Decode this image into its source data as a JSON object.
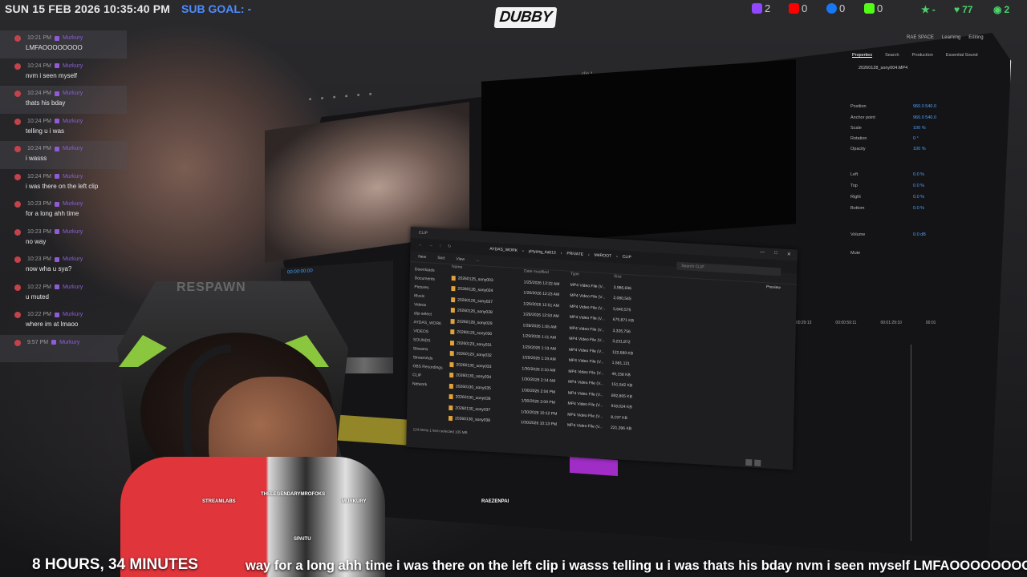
{
  "overlay": {
    "datetime": "SUN 15 FEB 2026 10:35:40 PM",
    "sub_goal": "SUB GOAL: -",
    "logo": "DUBBY",
    "socials": [
      {
        "icon": "twitch-icon",
        "count": "2",
        "color": "#9146ff"
      },
      {
        "icon": "youtube-icon",
        "count": "0",
        "color": "#ff0000"
      },
      {
        "icon": "facebook-icon",
        "count": "0",
        "color": "#1877f2"
      },
      {
        "icon": "kick-icon",
        "count": "0",
        "color": "#53fc18"
      }
    ],
    "stats": [
      {
        "icon": "star-icon",
        "count": "-"
      },
      {
        "icon": "heart-icon",
        "count": "77"
      },
      {
        "icon": "eye-icon",
        "count": "2"
      }
    ],
    "uptime": "8 HOURS, 34 MINUTES",
    "ticker": "way for a long ahh time i was there on the left clip i wasss telling u i was thats his bday nvm i seen myself LMFAOOOOOOOO"
  },
  "chat": [
    {
      "time": "10:21 PM",
      "user": "Murkury",
      "message": "LMFAOOOOOOOO",
      "highlight": true
    },
    {
      "time": "10:24 PM",
      "user": "Murkury",
      "message": "nvm i seen myself",
      "highlight": false
    },
    {
      "time": "10:24 PM",
      "user": "Murkury",
      "message": "thats his bday",
      "highlight": true
    },
    {
      "time": "10:24 PM",
      "user": "Murkury",
      "message": "telling u i was",
      "highlight": false
    },
    {
      "time": "10:24 PM",
      "user": "Murkury",
      "message": "i wasss",
      "highlight": true
    },
    {
      "time": "10:24 PM",
      "user": "Murkury",
      "message": "i was there on the left clip",
      "highlight": false
    },
    {
      "time": "10:23 PM",
      "user": "Murkury",
      "message": "for a long ahh time",
      "highlight": false
    },
    {
      "time": "10:23 PM",
      "user": "Murkury",
      "message": "no way",
      "highlight": false
    },
    {
      "time": "10:23 PM",
      "user": "Murkury",
      "message": "now wha u sya?",
      "highlight": false
    },
    {
      "time": "10:22 PM",
      "user": "Murkury",
      "message": "u muted",
      "highlight": false
    },
    {
      "time": "10:22 PM",
      "user": "Murkury",
      "message": "where im at lmaoo",
      "highlight": false
    },
    {
      "time": "9:57 PM",
      "user": "Murkury",
      "message": "",
      "highlight": true
    }
  ],
  "editor": {
    "sequence_title": "clip 1",
    "menu": [
      "RAE SPACE",
      "Learning",
      "Editing"
    ],
    "timecode": "00:00:00:00",
    "props_tabs": [
      "Properties",
      "Search",
      "Production",
      "Essential Sound"
    ],
    "props_file": "20260128_sony004.MP4",
    "props": [
      {
        "label": "Position",
        "value": "960.0   540.0"
      },
      {
        "label": "Anchor point",
        "value": "960.0   540.0"
      },
      {
        "label": "Scale",
        "value": "100 %"
      },
      {
        "label": "Rotation",
        "value": "0 °"
      },
      {
        "label": "Opacity",
        "value": "100 %"
      },
      {
        "label": "Left",
        "value": "0.0 %"
      },
      {
        "label": "Top",
        "value": "0.0 %"
      },
      {
        "label": "Right",
        "value": "0.0 %"
      },
      {
        "label": "Bottom",
        "value": "0.0 %"
      },
      {
        "label": "Volume",
        "value": "0.0 dB"
      },
      {
        "label": "Mute",
        "value": ""
      }
    ],
    "timeline_ticks": [
      "00:00:29:13",
      "00:00:59:11",
      "00:01:29:10",
      "00:01"
    ]
  },
  "explorer": {
    "title": "CLIP",
    "crumbs": [
      "AYDAS_WORK",
      "yinyang_4ab13",
      "PRIVATE",
      "M4ROOT",
      "CLIP"
    ],
    "search_placeholder": "Search CLIP",
    "toolbar": [
      "New",
      "Sort",
      "View",
      "..."
    ],
    "preview_label": "Preview",
    "sidebar": [
      "Downloads",
      "Documents",
      "Pictures",
      "Music",
      "Videos",
      "clip-select",
      "AYDAS_WORK",
      "VIDEOS",
      "SOUNDS",
      "Streams",
      "StreamAds",
      "OBS Recordings",
      "CLIP",
      "Network"
    ],
    "columns": [
      "Name",
      "Date modified",
      "Type",
      "Size"
    ],
    "rows": [
      {
        "name": "20260125_sony003",
        "date": "1/25/2026 12:22 AM",
        "type": "MP4 Video File (V...",
        "size": "3,986,696"
      },
      {
        "name": "20260126_sony024",
        "date": "1/26/2026 12:23 AM",
        "type": "MP4 Video File (V...",
        "size": "2,080,545"
      },
      {
        "name": "20260126_sony027",
        "date": "1/26/2026 12:51 AM",
        "type": "MP4 Video File (V...",
        "size": "5,640,575"
      },
      {
        "name": "20260126_sony028",
        "date": "1/26/2026 12:53 AM",
        "type": "MP4 Video File (V...",
        "size": "675,871 KB"
      },
      {
        "name": "20260128_sony029",
        "date": "1/28/2026 1:05 AM",
        "type": "MP4 Video File (V...",
        "size": "3,326,756"
      },
      {
        "name": "20260129_sony030",
        "date": "1/29/2026 1:11 AM",
        "type": "MP4 Video File (V...",
        "size": "3,231,872"
      },
      {
        "name": "20260129_sony031",
        "date": "1/29/2026 1:13 AM",
        "type": "MP4 Video File (V...",
        "size": "122,689 KB"
      },
      {
        "name": "20260129_sony032",
        "date": "1/29/2026 1:19 AM",
        "type": "MP4 Video File (V...",
        "size": "1,581,121"
      },
      {
        "name": "20260130_sony033",
        "date": "1/30/2026 2:10 AM",
        "type": "MP4 Video File (V...",
        "size": "49,158 KB"
      },
      {
        "name": "20260130_sony034",
        "date": "1/30/2026 2:14 AM",
        "type": "MP4 Video File (V...",
        "size": "151,542 KB"
      },
      {
        "name": "20260130_sony035",
        "date": "1/30/2026 2:04 PM",
        "type": "MP4 Video File (V...",
        "size": "892,865 KB"
      },
      {
        "name": "20260130_sony036",
        "date": "1/30/2026 2:09 PM",
        "type": "MP4 Video File (V...",
        "size": "918,024 KB"
      },
      {
        "name": "20260130_sony037",
        "date": "1/30/2026 10:12 PM",
        "type": "MP4 Video File (V...",
        "size": "8,197 KB"
      },
      {
        "name": "20260130_sony038",
        "date": "1/30/2026 10:13 PM",
        "type": "MP4 Video File (V...",
        "size": "221,396 KB"
      }
    ],
    "status": "124 items   1 item selected  105 MB"
  },
  "webcam": {
    "chair_brand": "RESPAWN",
    "labels": [
      "STREAMLABS",
      "THELEGENDARYMROFOKS",
      "MURKURY",
      "RAEZENPAI",
      "SPAITU"
    ]
  }
}
